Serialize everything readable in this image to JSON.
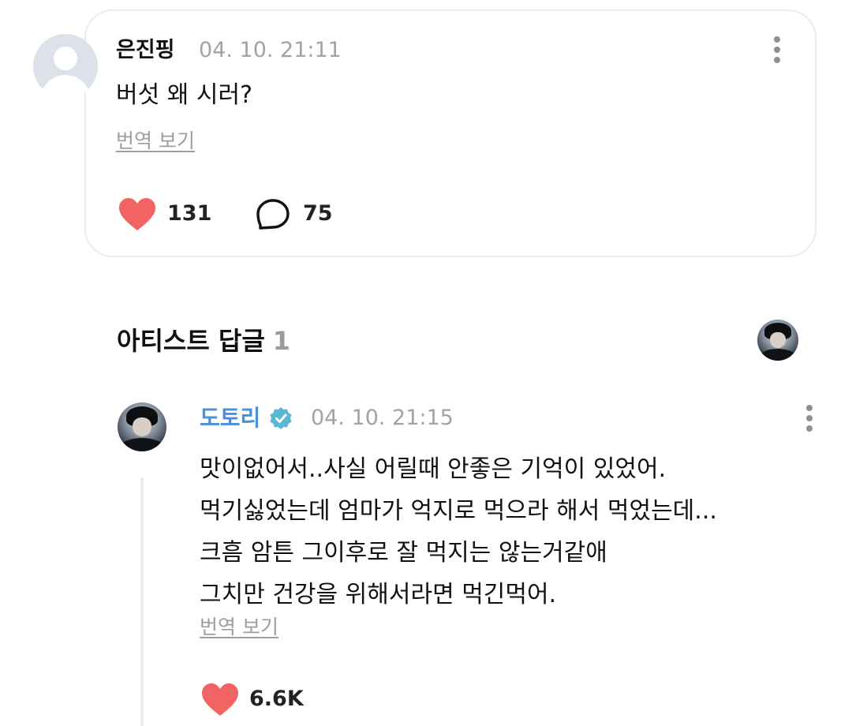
{
  "fan_comment": {
    "author": "은진핑",
    "timestamp": "04. 10. 21:11",
    "text": "버섯 왜 시러?",
    "translate_label": "번역 보기",
    "like_count": "131",
    "reply_count": "75",
    "like_icon": "heart-icon",
    "reply_icon": "speech-bubble-icon",
    "menu_icon": "more-vertical-icon"
  },
  "artist_replies": {
    "title": "아티스트 답글",
    "count": "1"
  },
  "artist_reply": {
    "author": "도토리",
    "verified_icon": "verified-badge-icon",
    "timestamp": "04. 10. 21:15",
    "lines": [
      "맛이없어서..사실 어릴때 안좋은 기억이 있었어.",
      "먹기싫었는데 엄마가 억지로 먹으라 해서 먹었는데...",
      "크흠 암튼 그이후로 잘 먹지는 않는거같애",
      "그치만 건강을 위해서라면 먹긴먹어."
    ],
    "translate_label": "번역 보기",
    "like_count": "6.6K",
    "like_icon": "heart-icon",
    "menu_icon": "more-vertical-icon"
  },
  "colors": {
    "heart": "#f26464",
    "artist_name": "#4a8fde",
    "verified_badge": "#5ab8d6",
    "muted_text": "#a3a3a3",
    "card_border": "#ececec"
  }
}
